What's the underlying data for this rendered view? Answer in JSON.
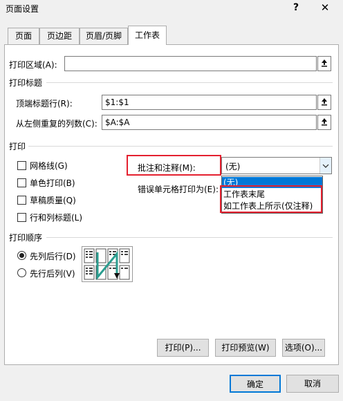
{
  "window": {
    "title": "页面设置",
    "help": "?",
    "close": "✕"
  },
  "tabs": [
    "页面",
    "页边距",
    "页眉/页脚",
    "工作表"
  ],
  "print_area": {
    "label": "打印区域(A):",
    "value": ""
  },
  "print_titles": {
    "section": "打印标题",
    "rows_label": "顶端标题行(R):",
    "rows_value": "$1:$1",
    "cols_label": "从左侧重复的列数(C):",
    "cols_value": "$A:$A"
  },
  "print": {
    "section": "打印",
    "gridlines": "网格线(G)",
    "black_white": "单色打印(B)",
    "draft": "草稿质量(Q)",
    "headings": "行和列标题(L)",
    "comments_label": "批注和注释(M):",
    "comments_value": "(无)",
    "errors_label": "错误单元格打印为(E):",
    "options": [
      "(无)",
      "工作表末尾",
      "如工作表上所示(仅注释)"
    ]
  },
  "page_order": {
    "section": "打印顺序",
    "down_then_over": "先列后行(D)",
    "over_then_down": "先行后列(V)",
    "selected": "down_then_over"
  },
  "buttons": {
    "print": "打印(P)...",
    "preview": "打印预览(W)",
    "options": "选项(O)...",
    "ok": "确定",
    "cancel": "取消"
  },
  "colors": {
    "accent": "#0078d7",
    "highlight": "#e4202f",
    "order_arrow": "#2a9d8f"
  }
}
